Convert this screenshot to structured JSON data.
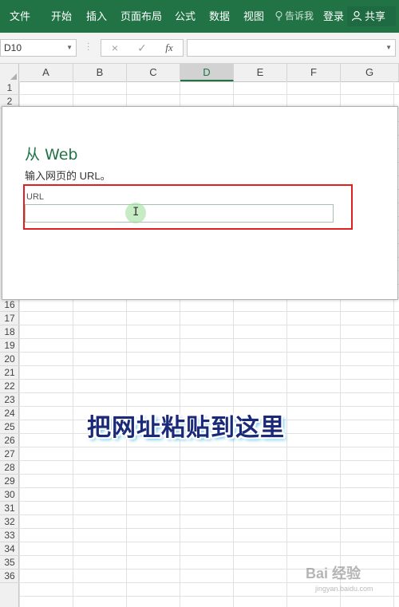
{
  "ribbon": {
    "tabs": [
      "文件",
      "开始",
      "插入",
      "页面布局",
      "公式",
      "数据",
      "视图"
    ],
    "tell_me": "告诉我",
    "login": "登录",
    "share": "共享",
    "colors": {
      "bar": "#217346"
    }
  },
  "formula_bar": {
    "name_box": "D10",
    "cancel_icon": "×",
    "enter_icon": "✓",
    "fx_label": "fx",
    "formula_value": ""
  },
  "grid": {
    "columns": [
      "A",
      "B",
      "C",
      "D",
      "E",
      "F",
      "G"
    ],
    "selected_column": "D",
    "rows_top": [
      "1",
      "2"
    ],
    "rows_bottom": [
      "16",
      "17",
      "18",
      "19",
      "20",
      "21",
      "22",
      "23",
      "24",
      "25",
      "26",
      "27",
      "28",
      "29",
      "30",
      "31",
      "32",
      "33",
      "34",
      "35",
      "36"
    ]
  },
  "dialog": {
    "title": "从 Web",
    "subtitle": "输入网页的 URL。",
    "url_label": "URL",
    "url_value": ""
  },
  "overlay_caption": "把网址粘贴到这里",
  "watermark": {
    "text": "Bai 经验",
    "sub": "jingyan.baidu.com"
  }
}
